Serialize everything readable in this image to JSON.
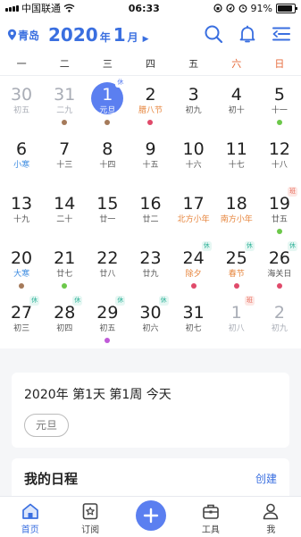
{
  "status": {
    "carrier": "中国联通",
    "time": "06:33",
    "battery": "91%"
  },
  "header": {
    "city": "青岛",
    "year": "2020",
    "year_unit": "年",
    "month": "1",
    "month_unit": "月"
  },
  "weekdays": [
    "一",
    "二",
    "三",
    "四",
    "五",
    "六",
    "日"
  ],
  "weeks": [
    [
      {
        "d": "30",
        "sub": "初五",
        "other": true
      },
      {
        "d": "31",
        "sub": "二九",
        "other": true,
        "dot": "#a57a5a"
      },
      {
        "d": "1",
        "sub": "元旦",
        "today": true,
        "badge": "休",
        "badge_type": "rest",
        "dot": "#a57a5a"
      },
      {
        "d": "2",
        "sub": "腊八节",
        "type": "holiday",
        "dot": "#e04a6a"
      },
      {
        "d": "3",
        "sub": "初九"
      },
      {
        "d": "4",
        "sub": "初十"
      },
      {
        "d": "5",
        "sub": "十一",
        "dot": "#6cc84a"
      }
    ],
    [
      {
        "d": "6",
        "sub": "小寒",
        "type": "term"
      },
      {
        "d": "7",
        "sub": "十三"
      },
      {
        "d": "8",
        "sub": "十四"
      },
      {
        "d": "9",
        "sub": "十五"
      },
      {
        "d": "10",
        "sub": "十六"
      },
      {
        "d": "11",
        "sub": "十七"
      },
      {
        "d": "12",
        "sub": "十八"
      }
    ],
    [
      {
        "d": "13",
        "sub": "十九"
      },
      {
        "d": "14",
        "sub": "二十"
      },
      {
        "d": "15",
        "sub": "廿一"
      },
      {
        "d": "16",
        "sub": "廿二"
      },
      {
        "d": "17",
        "sub": "北方小年",
        "type": "holiday"
      },
      {
        "d": "18",
        "sub": "南方小年",
        "type": "holiday"
      },
      {
        "d": "19",
        "sub": "廿五",
        "badge": "班",
        "badge_type": "work",
        "dot": "#6cc84a"
      }
    ],
    [
      {
        "d": "20",
        "sub": "大寒",
        "type": "term",
        "dot": "#a57a5a"
      },
      {
        "d": "21",
        "sub": "廿七",
        "dot": "#6cc84a"
      },
      {
        "d": "22",
        "sub": "廿八"
      },
      {
        "d": "23",
        "sub": "廿九"
      },
      {
        "d": "24",
        "sub": "除夕",
        "type": "holiday",
        "badge": "休",
        "badge_type": "rest",
        "dot": "#e04a6a"
      },
      {
        "d": "25",
        "sub": "春节",
        "type": "holiday",
        "badge": "休",
        "badge_type": "rest",
        "dot": "#e04a6a"
      },
      {
        "d": "26",
        "sub": "海关日",
        "badge": "休",
        "badge_type": "rest",
        "dot": "#e04a6a"
      }
    ],
    [
      {
        "d": "27",
        "sub": "初三",
        "badge": "休",
        "badge_type": "rest"
      },
      {
        "d": "28",
        "sub": "初四",
        "badge": "休",
        "badge_type": "rest"
      },
      {
        "d": "29",
        "sub": "初五",
        "badge": "休",
        "badge_type": "rest",
        "dot": "#c05ad8"
      },
      {
        "d": "30",
        "sub": "初六",
        "badge": "休",
        "badge_type": "rest"
      },
      {
        "d": "31",
        "sub": "初七"
      },
      {
        "d": "1",
        "sub": "初八",
        "other": true,
        "badge": "班",
        "badge_type": "work"
      },
      {
        "d": "2",
        "sub": "初九",
        "other": true
      }
    ]
  ],
  "info": {
    "summary": "2020年 第1天 第1周 今天",
    "festival": "元旦"
  },
  "schedule": {
    "title": "我的日程",
    "create": "创建"
  },
  "tabs": [
    {
      "label": "首页",
      "icon": "home-icon",
      "active": true
    },
    {
      "label": "订阅",
      "icon": "subscribe-icon"
    },
    {
      "label": "",
      "icon": "add-icon",
      "fab": true
    },
    {
      "label": "工具",
      "icon": "toolbox-icon"
    },
    {
      "label": "我",
      "icon": "profile-icon"
    }
  ],
  "colors": {
    "accent": "#5b7ff0",
    "weekend": "#e66a3a",
    "holiday": "#e6833a"
  }
}
